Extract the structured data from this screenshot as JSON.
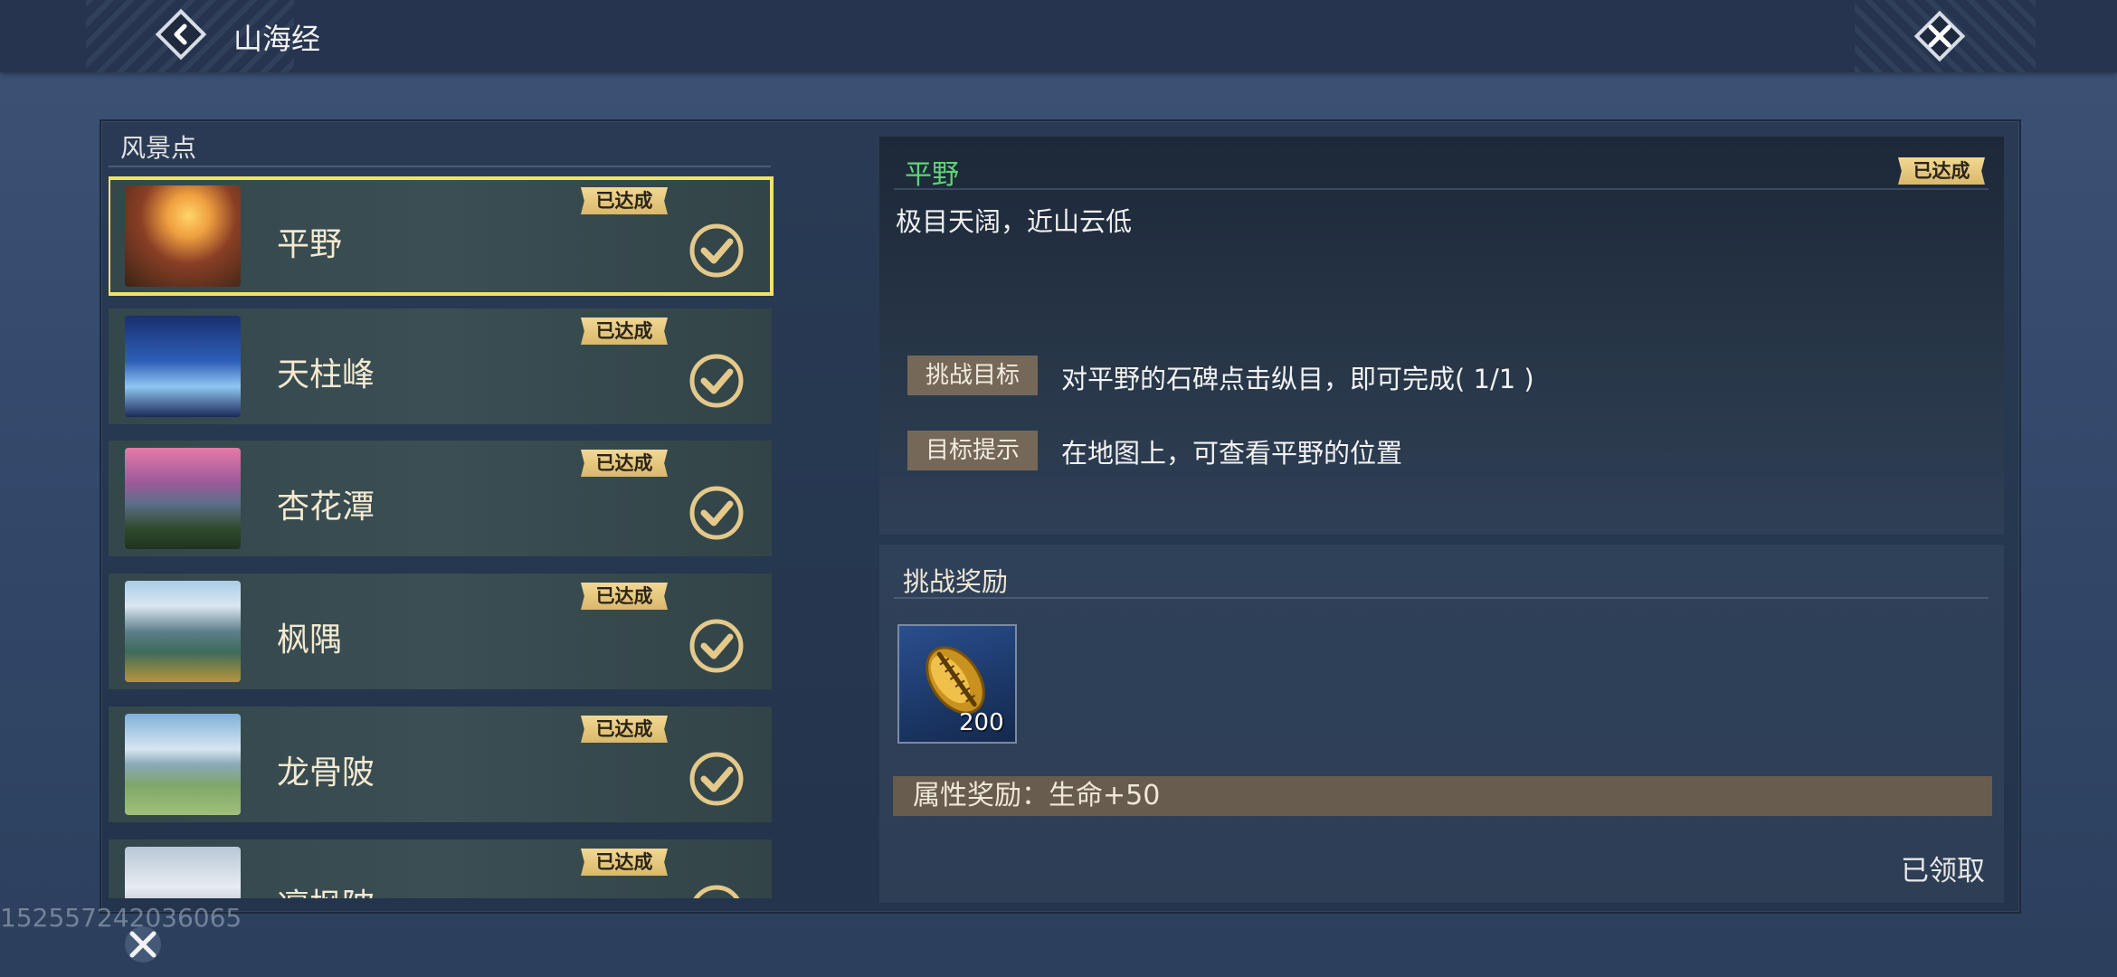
{
  "header": {
    "title": "山海经",
    "back_icon": "back-arrow-icon",
    "close_icon": "close-icon"
  },
  "list": {
    "heading": "风景点",
    "items": [
      {
        "name": "平野",
        "badge": "已达成",
        "thumb_colors": [
          "#f0b04a",
          "#7a3a22",
          "#3b2417"
        ]
      },
      {
        "name": "天柱峰",
        "badge": "已达成",
        "thumb_colors": [
          "#1a2f6e",
          "#3f7ad8",
          "#9bc9f0"
        ]
      },
      {
        "name": "杏花潭",
        "badge": "已达成",
        "thumb_colors": [
          "#e67aa8",
          "#6b3e7a",
          "#2f4a2c"
        ]
      },
      {
        "name": "枫隅",
        "badge": "已达成",
        "thumb_colors": [
          "#9bc4e4",
          "#3e6b6a",
          "#b7943a"
        ]
      },
      {
        "name": "龙骨陂",
        "badge": "已达成",
        "thumb_colors": [
          "#8db9dc",
          "#d8e6f0",
          "#7fa66a"
        ]
      },
      {
        "name": "凛枫陂",
        "badge": "已达成",
        "thumb_colors": [
          "#b9c7d6",
          "#e7ecf2",
          "#6a7f95"
        ]
      }
    ]
  },
  "detail": {
    "name": "平野",
    "badge": "已达成",
    "description": "极目天阔，近山云低",
    "challenge_tag": "挑战目标",
    "challenge_text": "对平野的石碑点击纵目，即可完成( 1/1 )",
    "hint_tag": "目标提示",
    "hint_text": "在地图上，可查看平野的位置"
  },
  "reward": {
    "title": "挑战奖励",
    "item_icon": "gold-shell-icon",
    "item_count": "200",
    "attr_text": "属性奖励：生命+50",
    "status": "已领取"
  },
  "watermark": "1525572420360​65",
  "colors": {
    "accent_green": "#5fd479",
    "badge_gold": "#e3c47c",
    "selected_border": "#f3e16a"
  }
}
